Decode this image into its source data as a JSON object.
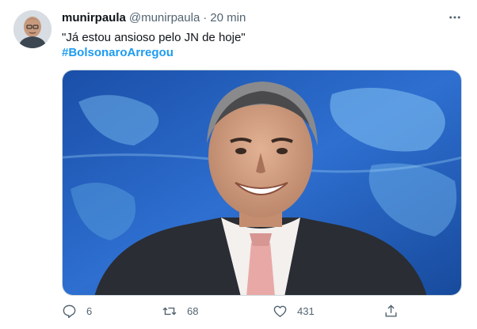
{
  "tweet": {
    "author_name": "munirpaula",
    "handle": "@munirpaula",
    "separator": "·",
    "time": "20 min",
    "text": "\"Já estou ansioso pelo JN de hoje\"",
    "hashtag": "#BolsonaroArregou",
    "counts": {
      "replies": "6",
      "retweets": "68",
      "likes": "431"
    }
  },
  "icons": {
    "more": "more-icon",
    "reply": "reply-icon",
    "retweet": "retweet-icon",
    "like": "like-icon",
    "share": "share-icon"
  },
  "colors": {
    "accent": "#1d9bf0",
    "secondary_text": "#536471",
    "primary_text": "#0f1419"
  }
}
